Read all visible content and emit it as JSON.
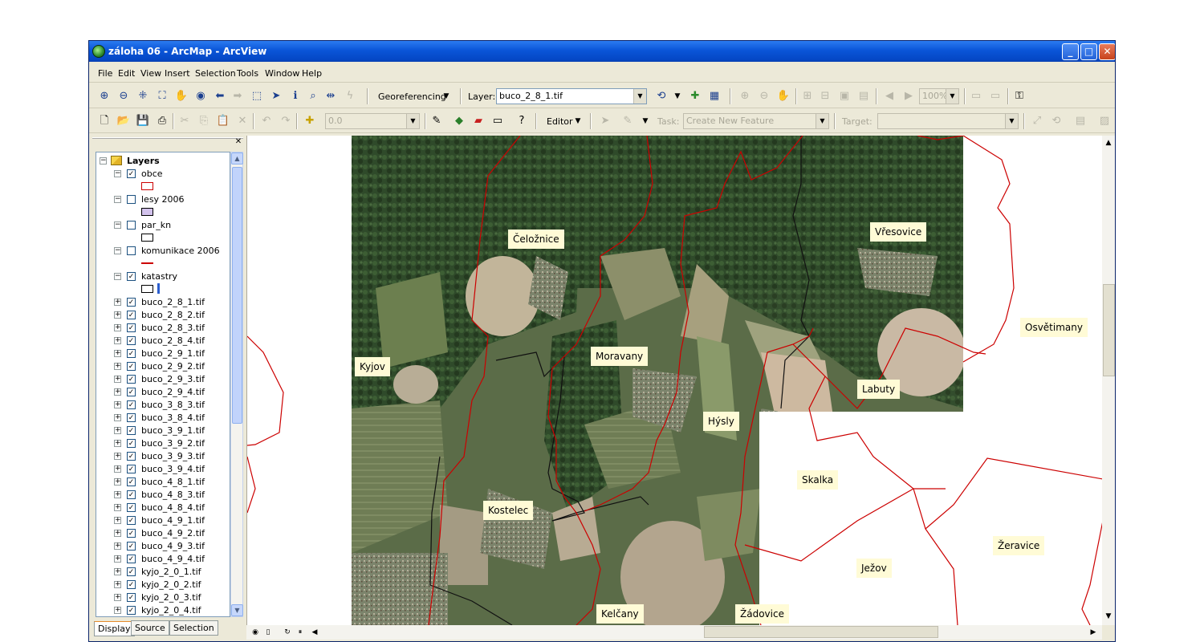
{
  "window": {
    "title": "záloha 06 - ArcMap - ArcView",
    "buttons": {
      "minimize": "_",
      "maximize": "□",
      "close": "✕"
    }
  },
  "menu": [
    "File",
    "Edit",
    "View",
    "Insert",
    "Selection",
    "Tools",
    "Window",
    "Help"
  ],
  "toolbar1": {
    "georeferencing_label": "Georeferencing",
    "layer_label": "Layer:",
    "layer_value": "buco_2_8_1.tif",
    "zoom_value": "100%"
  },
  "toolbar2": {
    "scale_value": "0.0",
    "editor_label": "Editor",
    "task_label": "Task:",
    "task_value": "Create New Feature",
    "target_label": "Target:",
    "target_value": ""
  },
  "toc": {
    "root_label": "Layers",
    "layers": [
      {
        "name": "obce",
        "checked": true,
        "expanded": true
      },
      {
        "name": "lesy 2006",
        "checked": false,
        "expanded": true
      },
      {
        "name": "par_kn",
        "checked": false,
        "expanded": true
      },
      {
        "name": "komunikace 2006",
        "checked": false,
        "expanded": true
      },
      {
        "name": "katastry",
        "checked": true,
        "expanded": true
      },
      {
        "name": "buco_2_8_1.tif",
        "checked": true
      },
      {
        "name": "buco_2_8_2.tif",
        "checked": true
      },
      {
        "name": "buco_2_8_3.tif",
        "checked": true
      },
      {
        "name": "buco_2_8_4.tif",
        "checked": true
      },
      {
        "name": "buco_2_9_1.tif",
        "checked": true
      },
      {
        "name": "buco_2_9_2.tif",
        "checked": true
      },
      {
        "name": "buco_2_9_3.tif",
        "checked": true
      },
      {
        "name": "buco_2_9_4.tif",
        "checked": true
      },
      {
        "name": "buco_3_8_3.tif",
        "checked": true
      },
      {
        "name": "buco_3_8_4.tif",
        "checked": true
      },
      {
        "name": "buco_3_9_1.tif",
        "checked": true
      },
      {
        "name": "buco_3_9_2.tif",
        "checked": true
      },
      {
        "name": "buco_3_9_3.tif",
        "checked": true
      },
      {
        "name": "buco_3_9_4.tif",
        "checked": true
      },
      {
        "name": "buco_4_8_1.tif",
        "checked": true
      },
      {
        "name": "buco_4_8_3.tif",
        "checked": true
      },
      {
        "name": "buco_4_8_4.tif",
        "checked": true
      },
      {
        "name": "buco_4_9_1.tif",
        "checked": true
      },
      {
        "name": "buco_4_9_2.tif",
        "checked": true
      },
      {
        "name": "buco_4_9_3.tif",
        "checked": true
      },
      {
        "name": "buco_4_9_4.tif",
        "checked": true
      },
      {
        "name": "kyjo_2_0_1.tif",
        "checked": true
      },
      {
        "name": "kyjo_2_0_2.tif",
        "checked": true
      },
      {
        "name": "kyjo_2_0_3.tif",
        "checked": true
      },
      {
        "name": "kyjo_2_0_4.tif",
        "checked": true
      }
    ],
    "tabs": [
      "Display",
      "Source",
      "Selection"
    ]
  },
  "map": {
    "labels": [
      "Čeložnice",
      "Vřesovice",
      "Kyjov",
      "Moravany",
      "Osvětimany",
      "Labuty",
      "Hýsly",
      "Skalka",
      "Kostelec",
      "Ježov",
      "Žeravice",
      "Kelčany",
      "Žádovice"
    ]
  },
  "colors": {
    "boundary": "#cc0000",
    "label_bg": "#fffbd6",
    "title_bar": "#0a55d8"
  }
}
